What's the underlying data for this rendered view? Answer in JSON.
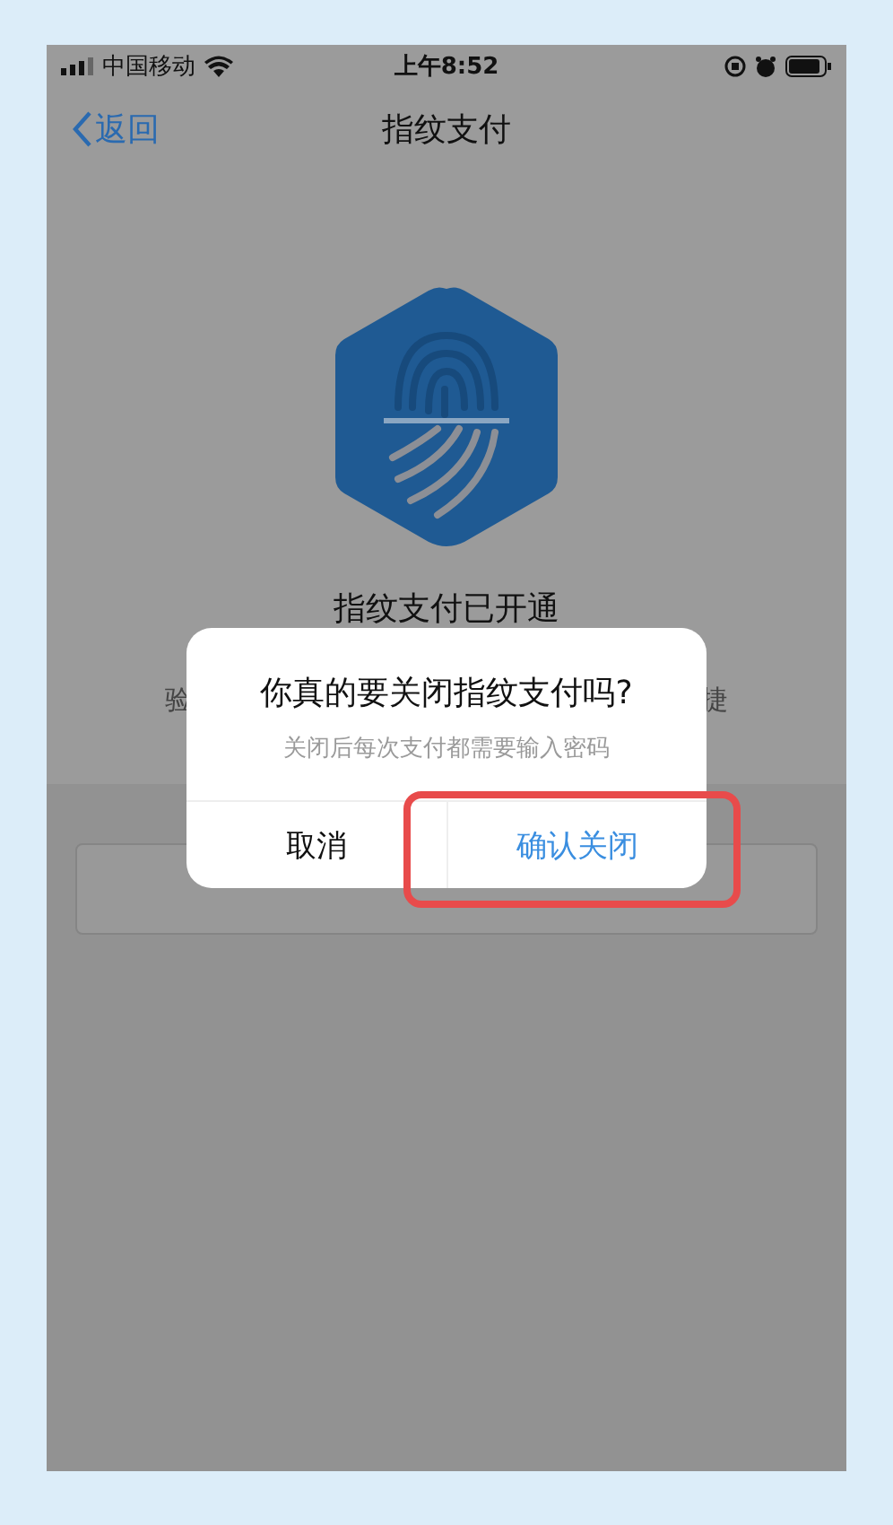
{
  "status_bar": {
    "carrier": "中国移动",
    "time": "上午8:52"
  },
  "nav": {
    "back": "返回",
    "title": "指纹支付"
  },
  "content": {
    "heading": "指纹支付已开通",
    "subtitle_left": "验",
    "subtitle_right": "捷"
  },
  "dialog": {
    "title": "你真的要关闭指纹支付吗?",
    "message": "关闭后每次支付都需要输入密码",
    "buttons": [
      {
        "label": "取消",
        "kind": "cancel",
        "highlighted": false
      },
      {
        "label": "确认关闭",
        "kind": "confirm",
        "highlighted": true
      }
    ]
  }
}
